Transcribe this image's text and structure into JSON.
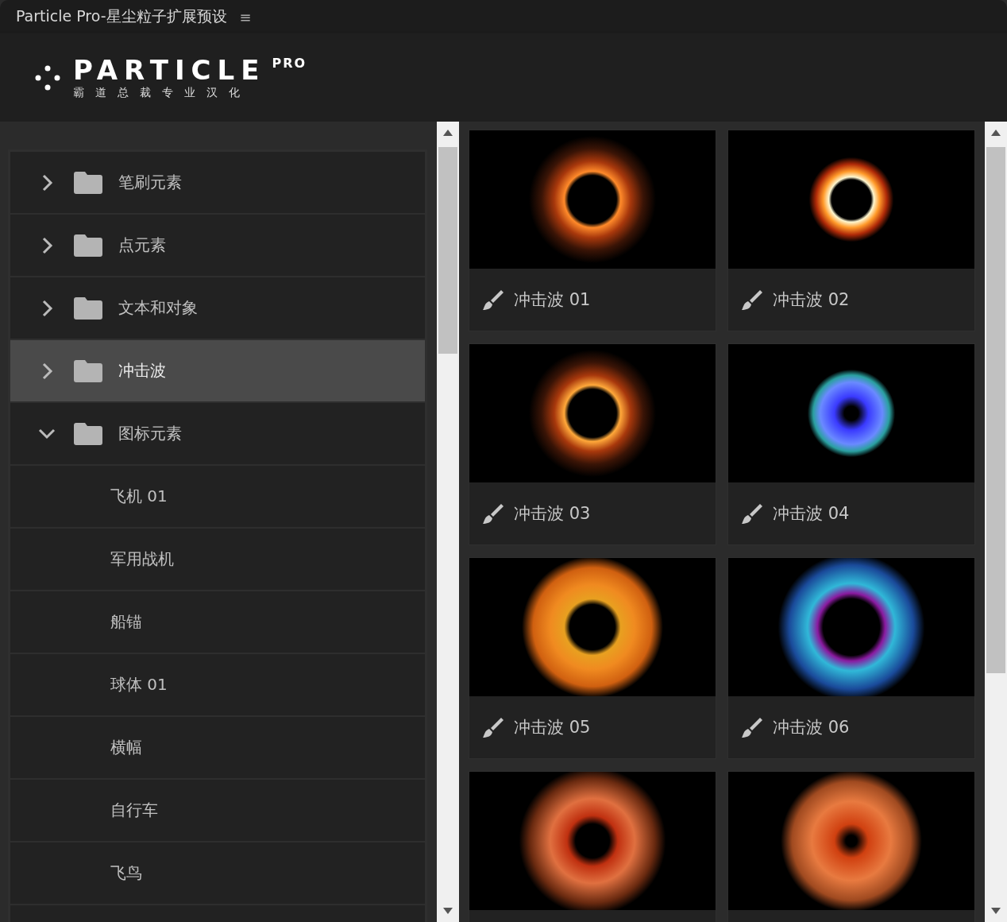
{
  "window": {
    "title": "Particle Pro-星尘粒子扩展预设",
    "menu_glyph": "≡"
  },
  "logo": {
    "wordmark": "PARTICLE",
    "superscript": "PRO",
    "tagline": "霸道总裁专业汉化"
  },
  "tree": [
    {
      "label": "笔刷元素",
      "expanded": false,
      "selected": false
    },
    {
      "label": "点元素",
      "expanded": false,
      "selected": false
    },
    {
      "label": "文本和对象",
      "expanded": false,
      "selected": false
    },
    {
      "label": "冲击波",
      "expanded": false,
      "selected": true
    },
    {
      "label": "图标元素",
      "expanded": true,
      "selected": false,
      "children": [
        {
          "label": "飞机 01",
          "selected": false
        },
        {
          "label": "军用战机",
          "selected": false
        },
        {
          "label": "船锚",
          "selected": false
        },
        {
          "label": "球体 01",
          "selected": false
        },
        {
          "label": "横幅",
          "selected": false
        },
        {
          "label": "自行车",
          "selected": false
        },
        {
          "label": "飞鸟",
          "selected": false
        }
      ]
    }
  ],
  "presets": [
    {
      "kind": "full",
      "label": "冲击波 01"
    },
    {
      "kind": "full",
      "label": "冲击波 02"
    },
    {
      "kind": "full",
      "label": "冲击波 03"
    },
    {
      "kind": "full",
      "label": "冲击波 04"
    },
    {
      "kind": "full",
      "label": "冲击波 05"
    },
    {
      "kind": "full",
      "label": "冲击波 06"
    },
    {
      "kind": "cut"
    },
    {
      "kind": "cut"
    }
  ]
}
